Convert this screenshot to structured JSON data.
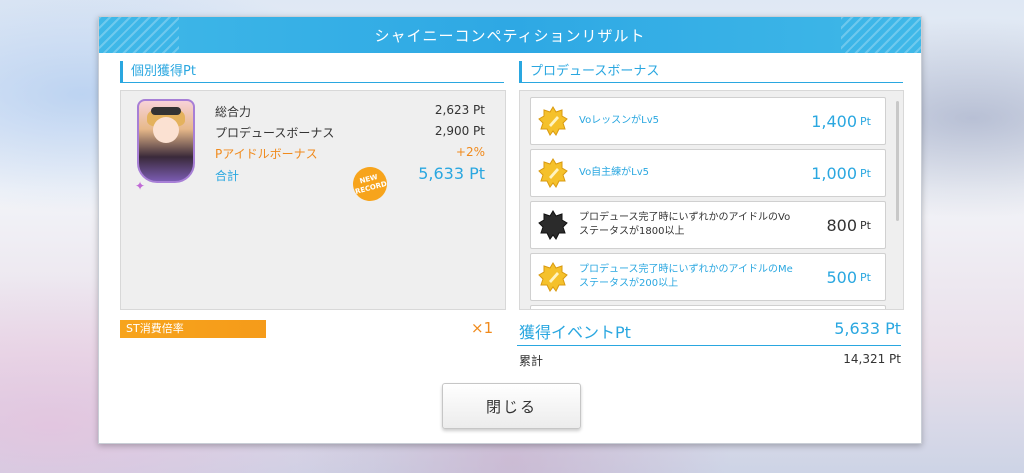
{
  "dialog": {
    "title": "シャイニーコンペティションリザルト"
  },
  "individual": {
    "heading": "個別獲得Pt",
    "new_record": "NEW RECORD",
    "rows": [
      {
        "label": "総合力",
        "value": "2,623 Pt"
      },
      {
        "label": "プロデュースボーナス",
        "value": "2,900 Pt"
      },
      {
        "label": "Pアイドルボーナス",
        "value": "+2%"
      },
      {
        "label": "合計",
        "value": "5,633 Pt"
      }
    ]
  },
  "produce_bonus": {
    "heading": "プロデュースボーナス",
    "items": [
      {
        "text": "VoレッスンがLv5",
        "points": "1,400",
        "unit": "Pt",
        "badge": "gold-star-badge"
      },
      {
        "text": "Vo自主練がLv5",
        "points": "1,000",
        "unit": "Pt",
        "badge": "gold-star-badge"
      },
      {
        "text": "プロデュース完了時にいずれかのアイドルのVoステータスが1800以上",
        "points": "800",
        "unit": "Pt",
        "badge": "black-star-badge"
      },
      {
        "text": "プロデュース完了時にいずれかのアイドルのMeステータスが200以上",
        "points": "500",
        "unit": "Pt",
        "badge": "gold-star-badge"
      }
    ]
  },
  "st": {
    "label": "ST消費倍率",
    "value": "×1"
  },
  "event": {
    "label": "獲得イベントPt",
    "value": "5,633 Pt",
    "total_label": "累計",
    "total_value": "14,321 Pt"
  },
  "buttons": {
    "close": "閉じる"
  },
  "colors": {
    "accent_blue": "#2aa7e0",
    "accent_orange": "#f7a41c",
    "title_bar": "#2ea8e4"
  }
}
